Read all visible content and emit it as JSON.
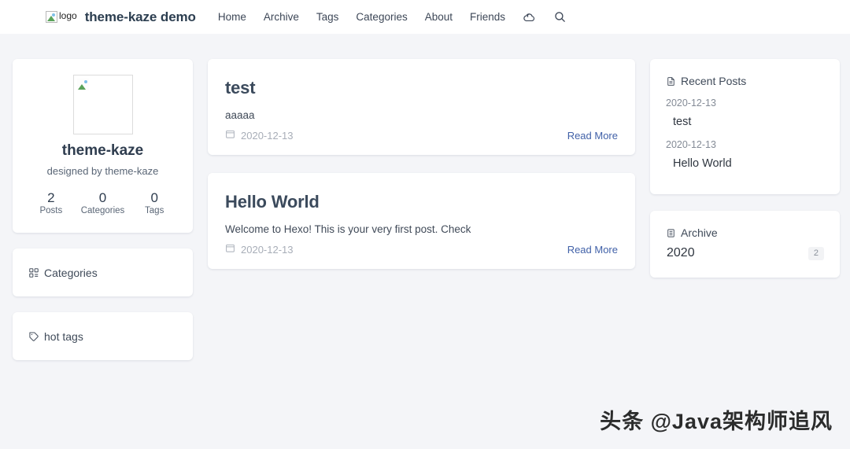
{
  "header": {
    "logo_alt": "logo",
    "site_title": "theme-kaze demo",
    "nav": [
      {
        "label": "Home"
      },
      {
        "label": "Archive"
      },
      {
        "label": "Tags"
      },
      {
        "label": "Categories"
      },
      {
        "label": "About"
      },
      {
        "label": "Friends"
      }
    ],
    "icons": {
      "theme_toggle": "cloud-moon-icon",
      "search": "search-icon"
    }
  },
  "profile": {
    "avatar_alt": "",
    "name": "theme-kaze",
    "description": "designed by theme-kaze",
    "stats": [
      {
        "count": "2",
        "label": "Posts"
      },
      {
        "count": "0",
        "label": "Categories"
      },
      {
        "count": "0",
        "label": "Tags"
      }
    ]
  },
  "sidebar_left": {
    "categories_widget": {
      "title": "Categories",
      "icon": "grid-icon"
    },
    "tags_widget": {
      "title": "hot tags",
      "icon": "tag-icon"
    }
  },
  "posts": [
    {
      "title": "test",
      "excerpt": "aaaaa",
      "date": "2020-12-13",
      "read_more": "Read More"
    },
    {
      "title": "Hello World",
      "excerpt": "Welcome to Hexo! This is your very first post. Check",
      "date": "2020-12-13",
      "read_more": "Read More"
    }
  ],
  "sidebar_right": {
    "recent_posts": {
      "title": "Recent Posts",
      "icon": "document-icon",
      "items": [
        {
          "date": "2020-12-13",
          "title": "test"
        },
        {
          "date": "2020-12-13",
          "title": "Hello World"
        }
      ]
    },
    "archive": {
      "title": "Archive",
      "icon": "clipboard-list-icon",
      "items": [
        {
          "year": "2020",
          "count": "2"
        }
      ]
    }
  },
  "watermark": {
    "text": "头条 @Java架构师追风"
  },
  "colors": {
    "page_bg": "#f4f5f8",
    "card_bg": "#ffffff",
    "link": "#4161a8",
    "heading": "#3b4a5c",
    "muted": "#a8aeb8"
  }
}
